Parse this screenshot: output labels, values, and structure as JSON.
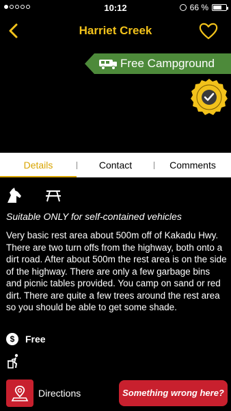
{
  "status_bar": {
    "time": "10:12",
    "battery_text": "66 %",
    "battery_level": 0.66
  },
  "nav": {
    "title": "Harriet Creek",
    "back_icon": "chevron-left-icon",
    "favorite_icon": "heart-outline-icon"
  },
  "hero": {
    "banner_label": "Free Campground",
    "banner_icon": "camper-icon",
    "badge_icon": "freedom-camping-badge-icon",
    "accent": "#4d8a3a"
  },
  "tabs": [
    {
      "label": "Details",
      "active": true
    },
    {
      "label": "Contact",
      "active": false
    },
    {
      "label": "Comments",
      "active": false
    }
  ],
  "details": {
    "amenity_icons": [
      "horse-icon",
      "picnic-table-icon"
    ],
    "suitability": "Suitable ONLY for self-contained vehicles",
    "description": "Very basic rest area about 500m off of Kakadu Hwy. There are two turn offs from the highway, both onto a dirt road. After about 500m the rest area is on the side of the highway. There are only a few garbage bins and picnic tables provided. You camp on sand or red dirt. There are quite a few trees around the rest area so you should be able to get some shade.",
    "fee_symbol": "$",
    "fee": "Free",
    "bin_icon": "rubbish-bin-icon"
  },
  "actions": {
    "directions_label": "Directions",
    "report_label": "Something wrong here?"
  },
  "colors": {
    "title_yellow": "#f2c21b",
    "tab_active": "#d8a400",
    "action_red": "#c8202e"
  }
}
